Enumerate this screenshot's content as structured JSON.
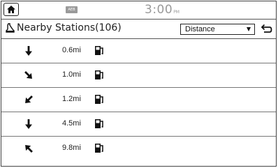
{
  "status": {
    "aeb_label": "AEB",
    "time": "3:00",
    "ampm": "PM"
  },
  "header": {
    "title": "Nearby Stations(106)",
    "sort_value": "Distance"
  },
  "stations": [
    {
      "direction": "S",
      "icon": "arrow-down-icon",
      "distance": "0.6mi"
    },
    {
      "direction": "SE",
      "icon": "arrow-down-right-icon",
      "distance": "1.0mi"
    },
    {
      "direction": "SW",
      "icon": "arrow-down-left-icon",
      "distance": "1.2mi"
    },
    {
      "direction": "S",
      "icon": "arrow-down-icon",
      "distance": "4.5mi"
    },
    {
      "direction": "NW",
      "icon": "arrow-up-left-icon",
      "distance": "9.8mi"
    }
  ],
  "colors": {
    "border": "#444444",
    "clock": "#9a9a9a",
    "aeb_badge": "#9a9a9a"
  }
}
